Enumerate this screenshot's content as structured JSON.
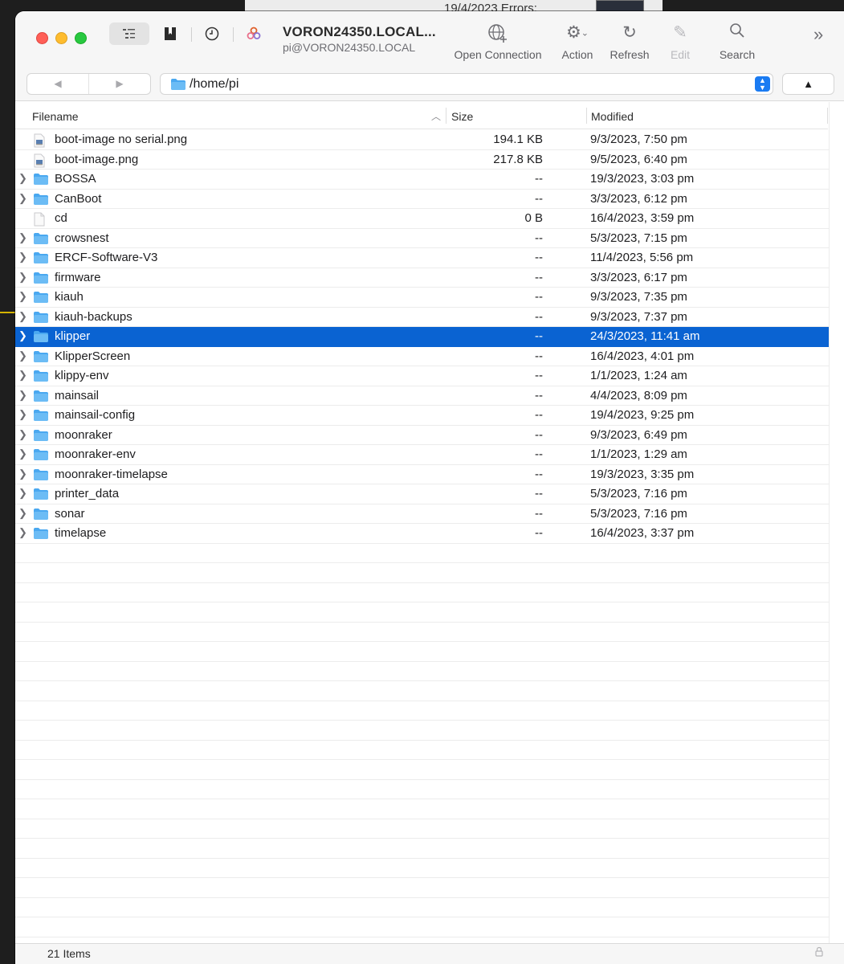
{
  "background": {
    "top_date": "19/4/2023  Errors:"
  },
  "window": {
    "title": "VORON24350.LOCAL...",
    "subtitle": "pi@VORON24350.LOCAL"
  },
  "toolbar": {
    "open_connection": "Open Connection",
    "action": "Action",
    "refresh": "Refresh",
    "edit": "Edit",
    "search": "Search"
  },
  "nav": {
    "back": "◀",
    "forward": "▶",
    "up": "▲"
  },
  "path": {
    "current": "/home/pi"
  },
  "columns": {
    "filename": "Filename",
    "size": "Size",
    "modified": "Modified"
  },
  "files": [
    {
      "name": "boot-image no serial.png",
      "size": "194.1 KB",
      "modified": "9/3/2023, 7:50 pm",
      "kind": "image",
      "expandable": false,
      "selected": false
    },
    {
      "name": "boot-image.png",
      "size": "217.8 KB",
      "modified": "9/5/2023, 6:40 pm",
      "kind": "image",
      "expandable": false,
      "selected": false
    },
    {
      "name": "BOSSA",
      "size": "--",
      "modified": "19/3/2023, 3:03 pm",
      "kind": "folder",
      "expandable": true,
      "selected": false
    },
    {
      "name": "CanBoot",
      "size": "--",
      "modified": "3/3/2023, 6:12 pm",
      "kind": "folder",
      "expandable": true,
      "selected": false
    },
    {
      "name": "cd",
      "size": "0 B",
      "modified": "16/4/2023, 3:59 pm",
      "kind": "file",
      "expandable": false,
      "selected": false
    },
    {
      "name": "crowsnest",
      "size": "--",
      "modified": "5/3/2023, 7:15 pm",
      "kind": "folder",
      "expandable": true,
      "selected": false
    },
    {
      "name": "ERCF-Software-V3",
      "size": "--",
      "modified": "11/4/2023, 5:56 pm",
      "kind": "folder",
      "expandable": true,
      "selected": false
    },
    {
      "name": "firmware",
      "size": "--",
      "modified": "3/3/2023, 6:17 pm",
      "kind": "folder",
      "expandable": true,
      "selected": false
    },
    {
      "name": "kiauh",
      "size": "--",
      "modified": "9/3/2023, 7:35 pm",
      "kind": "folder",
      "expandable": true,
      "selected": false
    },
    {
      "name": "kiauh-backups",
      "size": "--",
      "modified": "9/3/2023, 7:37 pm",
      "kind": "folder",
      "expandable": true,
      "selected": false
    },
    {
      "name": "klipper",
      "size": "--",
      "modified": "24/3/2023, 11:41 am",
      "kind": "folder",
      "expandable": true,
      "selected": true
    },
    {
      "name": "KlipperScreen",
      "size": "--",
      "modified": "16/4/2023, 4:01 pm",
      "kind": "folder",
      "expandable": true,
      "selected": false
    },
    {
      "name": "klippy-env",
      "size": "--",
      "modified": "1/1/2023, 1:24 am",
      "kind": "folder",
      "expandable": true,
      "selected": false
    },
    {
      "name": "mainsail",
      "size": "--",
      "modified": "4/4/2023, 8:09 pm",
      "kind": "folder",
      "expandable": true,
      "selected": false
    },
    {
      "name": "mainsail-config",
      "size": "--",
      "modified": "19/4/2023, 9:25 pm",
      "kind": "folder",
      "expandable": true,
      "selected": false
    },
    {
      "name": "moonraker",
      "size": "--",
      "modified": "9/3/2023, 6:49 pm",
      "kind": "folder",
      "expandable": true,
      "selected": false
    },
    {
      "name": "moonraker-env",
      "size": "--",
      "modified": "1/1/2023, 1:29 am",
      "kind": "folder",
      "expandable": true,
      "selected": false
    },
    {
      "name": "moonraker-timelapse",
      "size": "--",
      "modified": "19/3/2023, 3:35 pm",
      "kind": "folder",
      "expandable": true,
      "selected": false
    },
    {
      "name": "printer_data",
      "size": "--",
      "modified": "5/3/2023, 7:16 pm",
      "kind": "folder",
      "expandable": true,
      "selected": false
    },
    {
      "name": "sonar",
      "size": "--",
      "modified": "5/3/2023, 7:16 pm",
      "kind": "folder",
      "expandable": true,
      "selected": false
    },
    {
      "name": "timelapse",
      "size": "--",
      "modified": "16/4/2023, 3:37 pm",
      "kind": "folder",
      "expandable": true,
      "selected": false
    }
  ],
  "status": {
    "item_count": "21 Items"
  },
  "colors": {
    "selection": "#0a63d2",
    "folder": "#4aa8f0",
    "accent": "#1a7bf2"
  }
}
